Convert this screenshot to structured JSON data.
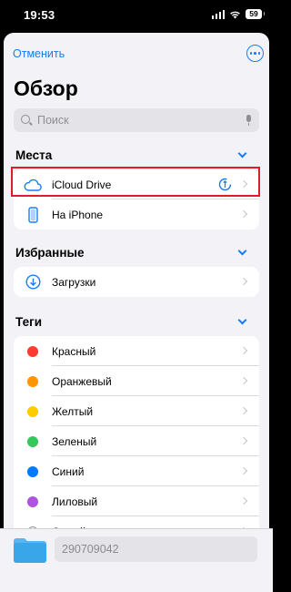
{
  "status_bar": {
    "time": "19:53",
    "battery": "59"
  },
  "nav": {
    "cancel_label": "Отменить",
    "more_icon": "ellipsis-circle-icon"
  },
  "title": "Обзор",
  "search": {
    "placeholder": "Поиск"
  },
  "sections": {
    "places": {
      "header": "Места",
      "items": [
        {
          "label": "iCloud Drive",
          "icon": "cloud-icon"
        },
        {
          "label": "На iPhone",
          "icon": "iphone-icon"
        }
      ]
    },
    "favorites": {
      "header": "Избранные",
      "items": [
        {
          "label": "Загрузки",
          "icon": "download-circle-icon"
        }
      ]
    },
    "tags": {
      "header": "Теги",
      "items": [
        {
          "label": "Красный",
          "color": "#ff3b30"
        },
        {
          "label": "Оранжевый",
          "color": "#ff9500"
        },
        {
          "label": "Желтый",
          "color": "#ffcc00"
        },
        {
          "label": "Зеленый",
          "color": "#34c759"
        },
        {
          "label": "Синий",
          "color": "#007aff"
        },
        {
          "label": "Лиловый",
          "color": "#af52de"
        },
        {
          "label": "Серый",
          "color": "#8e8e93"
        }
      ]
    }
  },
  "bottom": {
    "filename": "290709042"
  },
  "colors": {
    "accent": "#1a7cf2",
    "highlight": "#e01c24"
  }
}
